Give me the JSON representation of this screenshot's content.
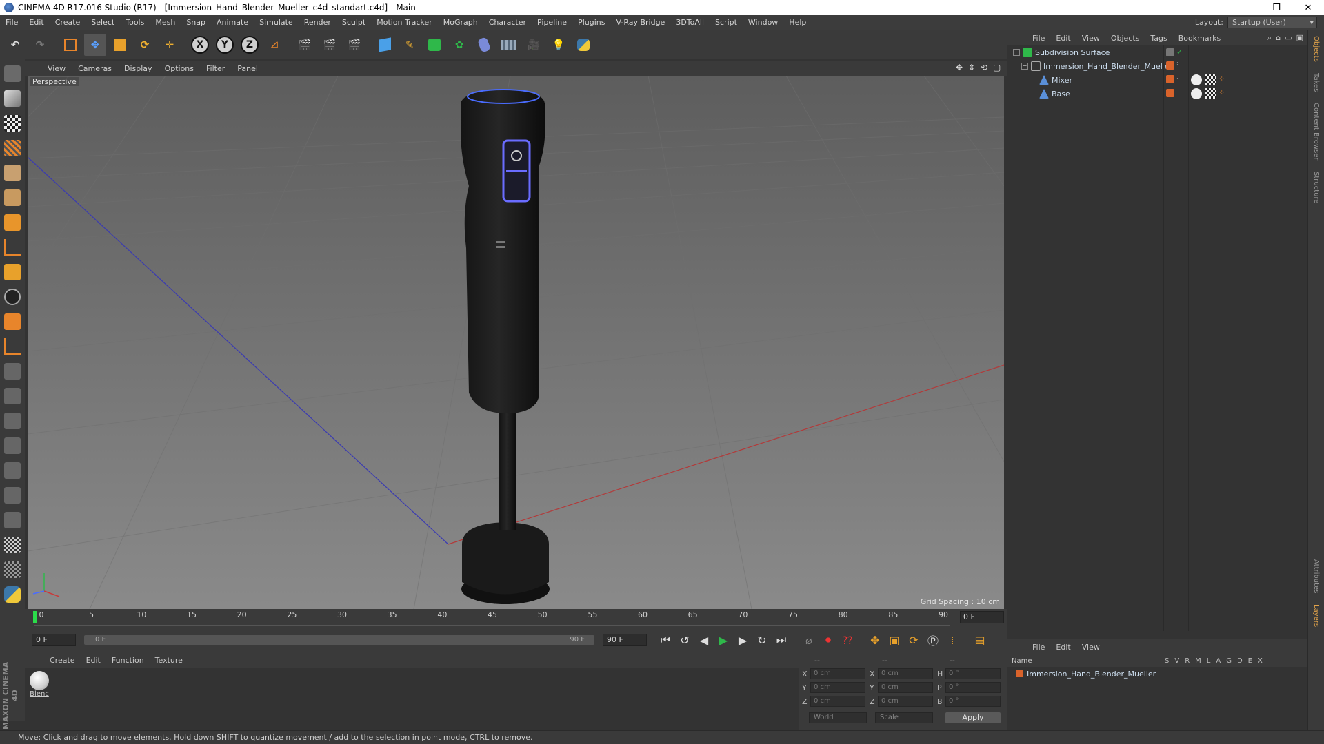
{
  "window": {
    "title": "CINEMA 4D R17.016 Studio (R17) - [Immersion_Hand_Blender_Mueller_c4d_standart.c4d] - Main",
    "controls": [
      "–",
      "❐",
      "✕"
    ]
  },
  "menu": {
    "items": [
      "File",
      "Edit",
      "Create",
      "Select",
      "Tools",
      "Mesh",
      "Snap",
      "Animate",
      "Simulate",
      "Render",
      "Sculpt",
      "Motion Tracker",
      "MoGraph",
      "Character",
      "Pipeline",
      "Plugins",
      "V-Ray Bridge",
      "3DToAll",
      "Script",
      "Window",
      "Help"
    ],
    "layout_label": "Layout:",
    "layout_value": "Startup (User)"
  },
  "toolbar": {
    "axis_x": "X",
    "axis_y": "Y",
    "axis_z": "Z"
  },
  "viewport": {
    "menu": [
      "View",
      "Cameras",
      "Display",
      "Options",
      "Filter",
      "Panel"
    ],
    "label": "Perspective",
    "grid_spacing": "Grid Spacing : 10 cm",
    "axis_colors": {
      "x": "#b23a3a",
      "z": "#3a3ab2"
    }
  },
  "timeline": {
    "ticks": [
      "0",
      "5",
      "10",
      "15",
      "20",
      "25",
      "30",
      "35",
      "40",
      "45",
      "50",
      "55",
      "60",
      "65",
      "70",
      "75",
      "80",
      "85",
      "90"
    ],
    "current_frame": "0 F"
  },
  "transport": {
    "start_field": "0 F",
    "slider_start": "0 F",
    "slider_end": "90 F",
    "end_field": "90 F"
  },
  "materials": {
    "menu": [
      "Create",
      "Edit",
      "Function",
      "Texture"
    ],
    "items": [
      {
        "name": "Blenc"
      }
    ]
  },
  "coordinates": {
    "headers": [
      "--",
      "--",
      "--"
    ],
    "rows": [
      {
        "a": "X",
        "v1": "0 cm",
        "b": "X",
        "v2": "0 cm",
        "c": "H",
        "v3": "0 °"
      },
      {
        "a": "Y",
        "v1": "0 cm",
        "b": "Y",
        "v2": "0 cm",
        "c": "P",
        "v3": "0 °"
      },
      {
        "a": "Z",
        "v1": "0 cm",
        "b": "Z",
        "v2": "0 cm",
        "c": "B",
        "v3": "0 °"
      }
    ],
    "space": "World",
    "mode": "Scale",
    "apply": "Apply"
  },
  "object_manager": {
    "menu": [
      "File",
      "Edit",
      "View",
      "Objects",
      "Tags",
      "Bookmarks"
    ],
    "objects": [
      {
        "name": "Subdivision Surface",
        "indent": 0,
        "color": "#2fb84a"
      },
      {
        "name": "Immersion_Hand_Blender_Mueller",
        "indent": 1,
        "color": "#aaaaaa"
      },
      {
        "name": "Mixer",
        "indent": 2,
        "color": "#5a8fd8"
      },
      {
        "name": "Base",
        "indent": 2,
        "color": "#5a8fd8"
      }
    ]
  },
  "layer_manager": {
    "menu": [
      "File",
      "Edit",
      "View"
    ],
    "header_name": "Name",
    "columns": [
      "S",
      "V",
      "R",
      "M",
      "L",
      "A",
      "G",
      "D",
      "E",
      "X"
    ],
    "layers": [
      {
        "name": "Immersion_Hand_Blender_Mueller",
        "color": "#d9632b"
      }
    ]
  },
  "side_tabs": [
    "Objects",
    "Takes",
    "Content Browser",
    "Structure"
  ],
  "side_tabs_bottom": [
    "Attributes",
    "Layers"
  ],
  "status": "Move: Click and drag to move elements. Hold down SHIFT to quantize movement / add to the selection in point mode, CTRL to remove.",
  "branding": "MAXON CINEMA 4D"
}
